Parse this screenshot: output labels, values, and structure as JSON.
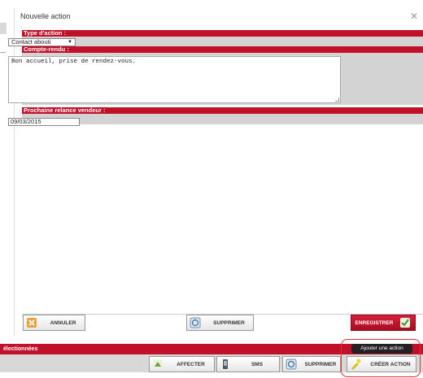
{
  "modal": {
    "title": "Nouvelle action",
    "close_glyph": "✕"
  },
  "form": {
    "type_label": "Type d'action :",
    "type_value": "Contact abouti",
    "compte_label": "Compte-rendu :",
    "compte_value": "Bon accueil, prise de rendez-vous.",
    "relance_label": "Prochaine relance vendeur :",
    "relance_value": "09/03/2015"
  },
  "buttons": {
    "annuler": "ANNULER",
    "supprimer": "SUPPRIMER",
    "enregistrer": "ENREGISTRER"
  },
  "page": {
    "selection_label": "électionnées",
    "affecter": "AFFECTER",
    "sms": "SMS",
    "supprimer": "SUPPRIMER",
    "creer_action": "CRÉER ACTION",
    "tooltip": "Ajouter une action"
  },
  "colors": {
    "brand_red": "#c0102a",
    "highlight": "#e23232"
  },
  "icons": {
    "annuler": "cancel-x-icon",
    "supprimer": "delete-icon",
    "enregistrer": "checkmark-icon",
    "affecter": "assign-icon",
    "sms": "phone-icon",
    "creer_action": "add-action-icon"
  }
}
